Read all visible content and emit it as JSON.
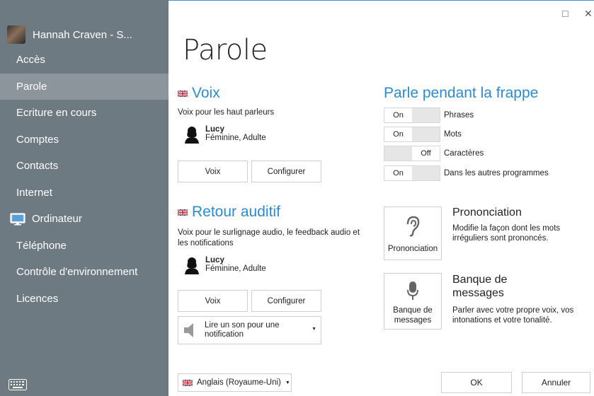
{
  "window": {
    "maximize_icon": "□",
    "close_icon": "✕"
  },
  "sidebar": {
    "profile_name": "Hannah Craven - S...",
    "items": [
      {
        "label": "Accès"
      },
      {
        "label": "Parole"
      },
      {
        "label": "Ecriture en cours"
      },
      {
        "label": "Comptes"
      },
      {
        "label": "Contacts"
      },
      {
        "label": "Internet"
      },
      {
        "label": "Ordinateur"
      },
      {
        "label": "Téléphone"
      },
      {
        "label": "Contrôle d'environnement"
      },
      {
        "label": "Licences"
      }
    ],
    "active_index": 1
  },
  "page": {
    "title": "Parole"
  },
  "voix": {
    "title": "Voix",
    "description": "Voix pour les haut parleurs",
    "voice_name": "Lucy",
    "voice_sub": "Féminine, Adulte",
    "voice_button": "Voix",
    "config_button": "Configurer"
  },
  "retour": {
    "title": "Retour auditif",
    "description": "Voix pour le surlignage audio, le feedback audio et les notifications",
    "voice_name": "Lucy",
    "voice_sub": "Féminine, Adulte",
    "voice_button": "Voix",
    "config_button": "Configurer",
    "notification_select": "Lire un son pour une notification"
  },
  "typing": {
    "title": "Parle pendant la frappe",
    "toggles": [
      {
        "state": "On",
        "label": "Phrases"
      },
      {
        "state": "On",
        "label": "Mots"
      },
      {
        "state": "Off",
        "label": "Caractères"
      },
      {
        "state": "On",
        "label": "Dans les autres programmes"
      }
    ]
  },
  "pronunciation": {
    "tile_label": "Prononciation",
    "title": "Prononciation",
    "description": "Modifie la façon dont les mots irréguliers sont prononcés."
  },
  "messages": {
    "tile_label": "Banque de messages",
    "title": "Banque de messages",
    "description": "Parler avec votre propre voix, vos intonations et votre tonalité."
  },
  "footer": {
    "language": "Anglais (Royaume-Uni)",
    "ok": "OK",
    "cancel": "Annuler"
  },
  "colors": {
    "accent": "#2a8bd3",
    "sidebar": "#6e7a82",
    "sidebar_active": "#8b959b"
  }
}
